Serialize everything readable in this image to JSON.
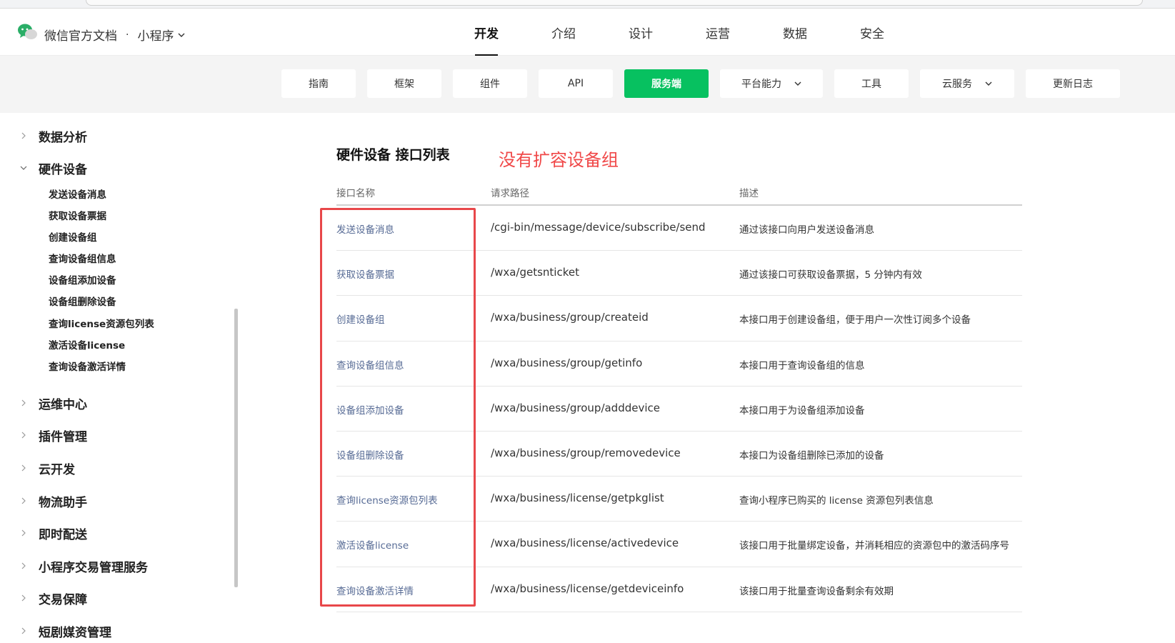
{
  "header": {
    "brand": "微信官方文档",
    "separator": "·",
    "product": "小程序",
    "nav": [
      "开发",
      "介绍",
      "设计",
      "运营",
      "数据",
      "安全"
    ],
    "active_nav": "开发"
  },
  "subnav": [
    {
      "label": "指南"
    },
    {
      "label": "框架"
    },
    {
      "label": "组件"
    },
    {
      "label": "API"
    },
    {
      "label": "服务端",
      "active": true
    },
    {
      "label": "平台能力",
      "dropdown": true
    },
    {
      "label": "工具"
    },
    {
      "label": "云服务",
      "dropdown": true
    },
    {
      "label": "更新日志"
    }
  ],
  "sidebar": {
    "groups": [
      {
        "label": "数据分析",
        "expanded": false
      },
      {
        "label": "硬件设备",
        "expanded": true
      },
      {
        "label": "运维中心",
        "expanded": false
      },
      {
        "label": "插件管理",
        "expanded": false
      },
      {
        "label": "云开发",
        "expanded": false
      },
      {
        "label": "物流助手",
        "expanded": false
      },
      {
        "label": "即时配送",
        "expanded": false
      },
      {
        "label": "小程序交易管理服务",
        "expanded": false
      },
      {
        "label": "交易保障",
        "expanded": false
      },
      {
        "label": "短剧媒资管理",
        "expanded": false
      }
    ],
    "subitems": [
      "发送设备消息",
      "获取设备票据",
      "创建设备组",
      "查询设备组信息",
      "设备组添加设备",
      "设备组删除设备",
      "查询license资源包列表",
      "激活设备license",
      "查询设备激活详情"
    ]
  },
  "main": {
    "title": "硬件设备 接口列表",
    "annotation": "没有扩容设备组",
    "columns": [
      "接口名称",
      "请求路径",
      "描述"
    ],
    "rows": [
      {
        "name": "发送设备消息",
        "path": "/cgi-bin/message/device/subscribe/send",
        "desc": "通过该接口向用户发送设备消息"
      },
      {
        "name": "获取设备票据",
        "path": "/wxa/getsnticket",
        "desc": "通过该接口可获取设备票据，5 分钟内有效"
      },
      {
        "name": "创建设备组",
        "path": "/wxa/business/group/createid",
        "desc": "本接口用于创建设备组，便于用户一次性订阅多个设备"
      },
      {
        "name": "查询设备组信息",
        "path": "/wxa/business/group/getinfo",
        "desc": "本接口用于查询设备组的信息"
      },
      {
        "name": "设备组添加设备",
        "path": "/wxa/business/group/adddevice",
        "desc": "本接口用于为设备组添加设备"
      },
      {
        "name": "设备组删除设备",
        "path": "/wxa/business/group/removedevice",
        "desc": "本接口为设备组删除已添加的设备"
      },
      {
        "name": "查询license资源包列表",
        "path": "/wxa/business/license/getpkglist",
        "desc": "查询小程序已购买的 license 资源包列表信息"
      },
      {
        "name": "激活设备license",
        "path": "/wxa/business/license/activedevice",
        "desc": "该接口用于批量绑定设备，并消耗相应的资源包中的激活码序号"
      },
      {
        "name": "查询设备激活详情",
        "path": "/wxa/business/license/getdeviceinfo",
        "desc": "该接口用于批量查询设备剩余有效期"
      }
    ]
  },
  "colors": {
    "accent": "#07c160",
    "link": "#576b95",
    "annotation": "#f04848"
  }
}
